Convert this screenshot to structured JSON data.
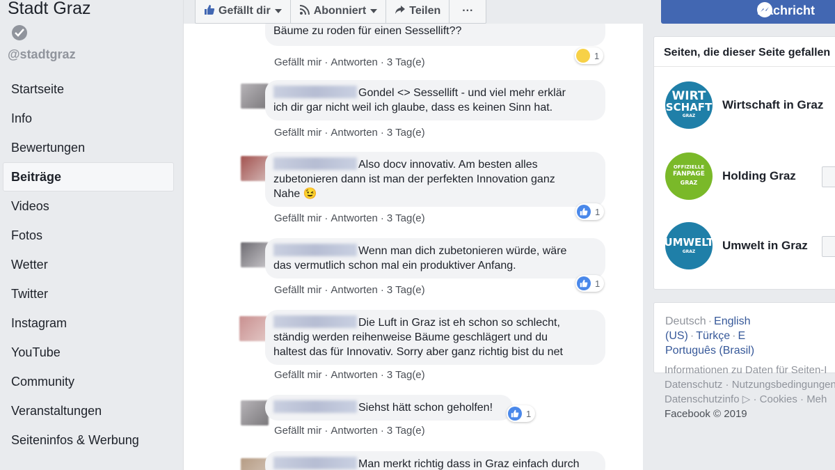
{
  "page": {
    "name": "Stadt Graz",
    "handle": "@stadtgraz"
  },
  "sidebar": {
    "items": [
      {
        "label": "Startseite"
      },
      {
        "label": "Info"
      },
      {
        "label": "Bewertungen"
      },
      {
        "label": "Beiträge",
        "active": true
      },
      {
        "label": "Videos"
      },
      {
        "label": "Fotos"
      },
      {
        "label": "Wetter"
      },
      {
        "label": "Twitter"
      },
      {
        "label": "Instagram"
      },
      {
        "label": "YouTube"
      },
      {
        "label": "Community"
      },
      {
        "label": "Veranstaltungen"
      },
      {
        "label": "Seiteninfos & Werbung"
      }
    ]
  },
  "actions": {
    "like": "Gefällt dir",
    "follow": "Abonniert",
    "share": "Teilen",
    "more": "···",
    "message": "Nachricht"
  },
  "comments": [
    {
      "text": "Bäume zu roden für einen Sessellift??",
      "reaction": "sad",
      "count": "1"
    },
    {
      "line1": "Gondel <> Sessellift - und viel mehr erklär",
      "line2": "ich dir gar nicht weil ich glaube, dass es keinen Sinn hat."
    },
    {
      "line1": "Also docv innovativ. Am besten alles",
      "line2": "zubetonieren dann ist man der perfekten Innovation ganz",
      "line3": "Nahe 😉",
      "reaction": "like",
      "count": "1"
    },
    {
      "line1": "Wenn man dich zubetonieren würde, wäre",
      "line2": "das vermutlich schon mal ein produktiver Anfang.",
      "reaction": "like",
      "count": "1"
    },
    {
      "line1": "Die Luft in Graz ist eh schon so schlecht,",
      "line2": "ständig werden reihenweise Bäume geschlägert und du",
      "line3": "haltest das für Innovativ. Sorry aber ganz richtig bist du net"
    },
    {
      "line1": "Siehst hätt schon geholfen!",
      "reaction": "like",
      "count": "1"
    },
    {
      "line1": "Man merkt richtig dass in Graz einfach durch"
    }
  ],
  "comment_meta": {
    "like": "Gefällt mir",
    "reply": "Antworten",
    "time": "3 Tag(e)"
  },
  "right": {
    "liked_title": "Seiten, die dieser Seite gefallen",
    "liked_pages": [
      {
        "name": "Wirtschaft in Graz",
        "logo_line1": "WIRT",
        "logo_line2": "SCHAFT",
        "logo_sub": "GRAZ",
        "color": "#1f7fa8"
      },
      {
        "name": "Holding Graz",
        "logo_line1": "OFFIZIELLE",
        "logo_line2": "FANPAGE",
        "logo_sub": "GRAZ",
        "color": "#7ab929"
      },
      {
        "name": "Umwelt in Graz",
        "logo_line1": "UMWELT",
        "logo_line2": "",
        "logo_sub": "GRAZ",
        "color": "#1f7fa8"
      }
    ],
    "languages": {
      "current": "Deutsch",
      "l1": "English (US)",
      "l2": "Türkçe",
      "l3": "E",
      "l4": "Português (Brasil)"
    },
    "footer": {
      "f1": "Informationen zu Daten für Seiten-I",
      "f2": "Datenschutz",
      "f3": "Nutzungsbedingungen",
      "f4": "Datenschutzinfo",
      "f5": "Cookies",
      "f6": "Meh",
      "copyright": "Facebook © 2019"
    }
  },
  "colors": {
    "facebook_blue": "#4267b2",
    "link": "#365899",
    "background": "#e9ebee"
  }
}
